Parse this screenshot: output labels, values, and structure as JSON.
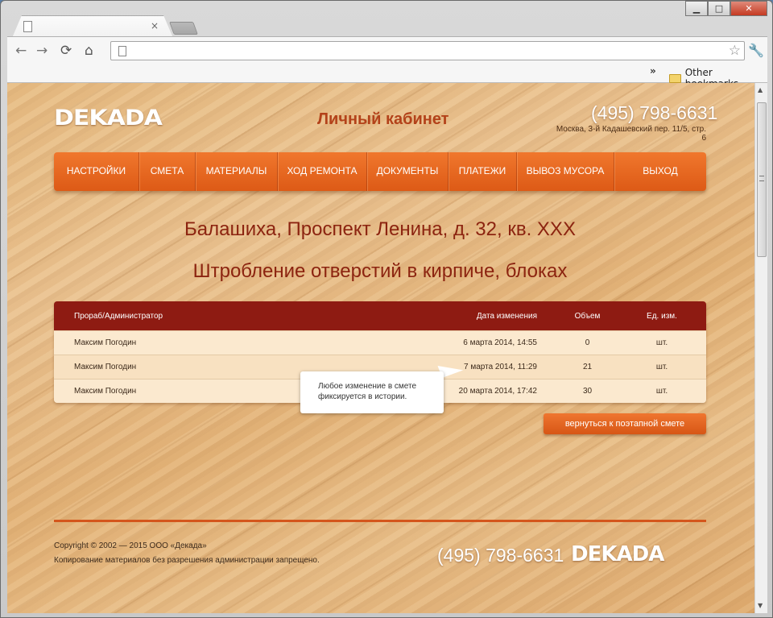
{
  "browser": {
    "tab_close": "×",
    "controls": {
      "minimize": "▁",
      "maximize": "□",
      "close": "✕"
    },
    "nav": {
      "back": "←",
      "forward": "→",
      "reload": "⟳",
      "home": "⌂"
    },
    "star": "☆",
    "wrench": "🔧",
    "bookmarks_chevron": "»",
    "other_bookmarks": "Other bookmarks"
  },
  "site": {
    "logo": "DEKADA",
    "title": "Личный кабинет",
    "phone": "(495) 798-6631",
    "address": "Москва, 3-й Кадашевский пер. 11/5, стр. 6"
  },
  "menu": [
    "НАСТРОЙКИ",
    "СМЕТА",
    "МАТЕРИАЛЫ",
    "ХОД РЕМОНТА",
    "ДОКУМЕНТЫ",
    "ПЛАТЕЖИ",
    "ВЫВОЗ МУСОРА",
    "ВЫХОД"
  ],
  "page": {
    "address_heading": "Балашиха, Проспект Ленина, д. 32, кв. XXX",
    "work_heading": "Штробление отверстий в кирпиче, блоках"
  },
  "table": {
    "headers": {
      "name": "Прораб/Администратор",
      "date": "Дата изменения",
      "volume": "Объем",
      "unit": "Ед. изм."
    },
    "rows": [
      {
        "name": "Максим Погодин",
        "date": "6 марта 2014, 14:55",
        "volume": "0",
        "unit": "шт."
      },
      {
        "name": "Максим Погодин",
        "date": "7 марта 2014, 11:29",
        "volume": "21",
        "unit": "шт."
      },
      {
        "name": "Максим Погодин",
        "date": "20 марта 2014, 17:42",
        "volume": "30",
        "unit": "шт."
      }
    ]
  },
  "tooltip": {
    "line1": "Любое изменение в смете",
    "line2": "фиксируется в истории."
  },
  "back_button": "вернуться к поэтапной смете",
  "footer": {
    "copyright": "Copyright © 2002 — 2015 ООО «Декада»",
    "notice": "Копирование материалов без разрешения администрации запрещено.",
    "phone": "(495) 798-6631",
    "logo": "DEKADA"
  }
}
